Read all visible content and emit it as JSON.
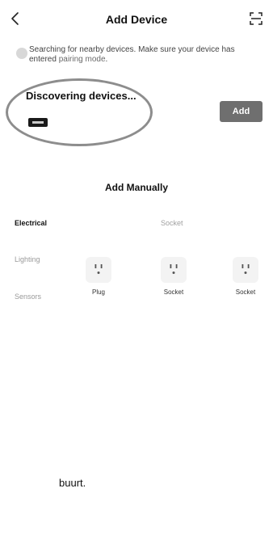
{
  "header": {
    "title": "Add Device",
    "back_icon": "chevron-left-icon",
    "scan_icon": "scan-icon"
  },
  "notice": {
    "text": "Searching for nearby devices. Make sure your device has entered ",
    "link": "pairing mode",
    "suffix": "."
  },
  "discovering": {
    "title": "Discovering devices...",
    "add_label": "Add"
  },
  "manual": {
    "title": "Add Manually",
    "categories": [
      {
        "label": "Electrical",
        "active": true
      },
      {
        "label": "Lighting",
        "active": false
      },
      {
        "label": "Sensors",
        "active": false
      }
    ],
    "group_label": "Socket",
    "devices": [
      {
        "label": "Plug",
        "icon": "outlet-icon"
      },
      {
        "label": "Socket",
        "icon": "outlet-icon"
      },
      {
        "label": "Socket",
        "icon": "outlet-icon"
      }
    ]
  },
  "footer": {
    "text": "buurt."
  },
  "colors": {
    "accent_button": "#6f6f6f",
    "ellipse": "#8d8d8d"
  }
}
